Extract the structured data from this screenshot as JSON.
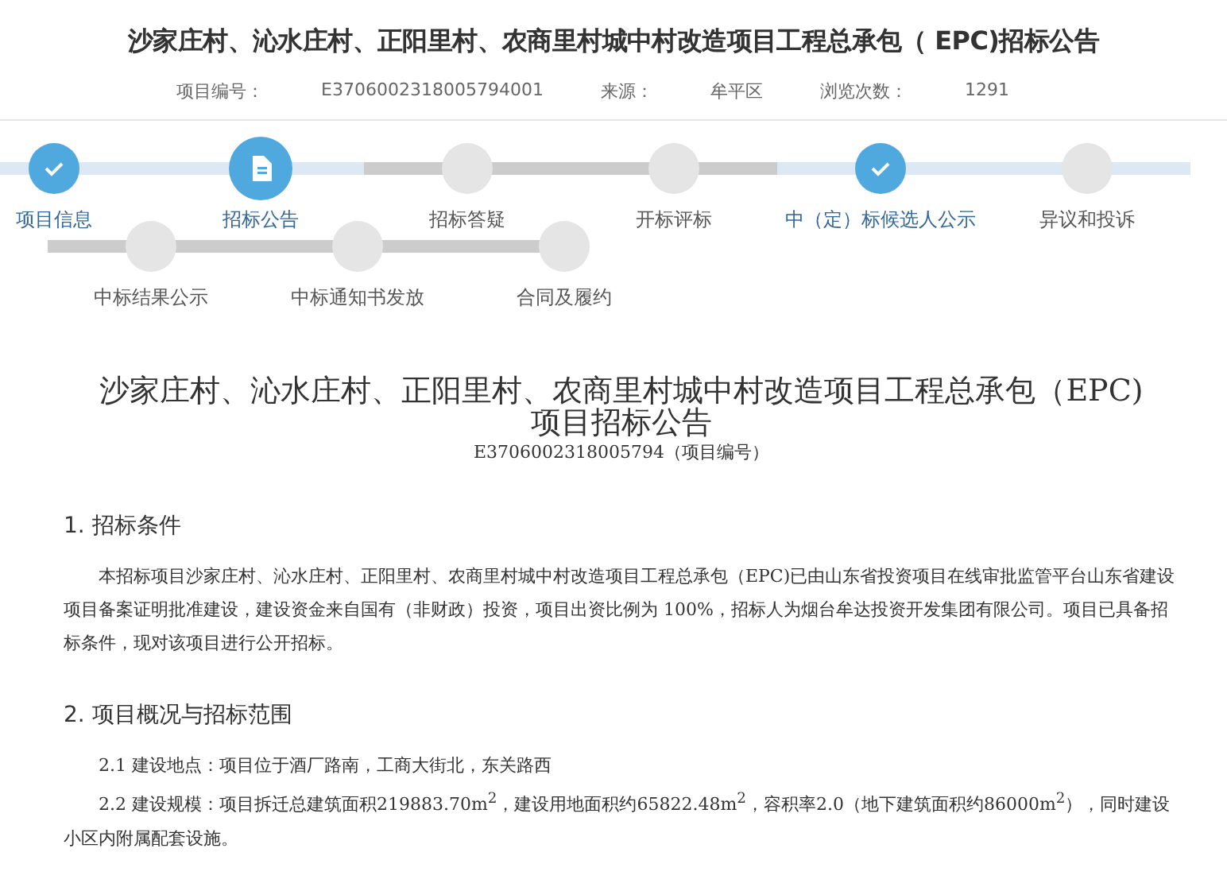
{
  "header": {
    "title": "沙家庄村、沁水庄村、正阳里村、农商里村城中村改造项目工程总承包（ EPC)招标公告",
    "meta": [
      {
        "label": "项目编号：",
        "value": "E3706002318005794001"
      },
      {
        "label": "来源：",
        "value": "牟平区"
      },
      {
        "label": "浏览次数：",
        "value": "1291"
      }
    ]
  },
  "steps": [
    [
      {
        "label": "项目信息",
        "completed": true,
        "selected": false,
        "highlighted": true
      },
      {
        "label": "招标公告",
        "completed": false,
        "selected": true,
        "highlighted": true
      },
      {
        "label": "招标答疑",
        "completed": false,
        "selected": false,
        "highlighted": false
      },
      {
        "label": "开标评标",
        "completed": false,
        "selected": false,
        "highlighted": false
      },
      {
        "label": "中（定）标候选人公示",
        "completed": true,
        "selected": false,
        "highlighted": true
      },
      {
        "label": "异议和投诉",
        "completed": false,
        "selected": false,
        "highlighted": true
      }
    ],
    [
      {
        "label": "中标结果公示",
        "completed": false,
        "selected": false,
        "highlighted": false
      },
      {
        "label": "中标通知书发放",
        "completed": false,
        "selected": false,
        "highlighted": false
      },
      {
        "label": "合同及履约",
        "completed": false,
        "selected": false,
        "highlighted": false
      }
    ]
  ],
  "document": {
    "title": "沙家庄村、沁水庄村、正阳里村、农商里村城中村改造项目工程总承包（EPC)项目招标公告",
    "code": "E3706002318005794（项目编号）",
    "sections": [
      {
        "heading": "1. 招标条件",
        "paragraphs": [
          {
            "text": "本招标项目沙家庄村、沁水庄村、正阳里村、农商里村城中村改造项目工程总承包（EPC)已由山东省投资项目在线审批监管平台山东省建设项目备案证明批准建设，建设资金来自国有（非财政）投资，项目出资比例为 100%，招标人为烟台牟达投资开发集团有限公司。项目已具备招标条件，现对该项目进行公开招标。"
          }
        ]
      },
      {
        "heading": "2. 项目概况与招标范围",
        "paragraphs": [
          {
            "text": "2.1 建设地点：项目位于酒厂路南，工商大街北，东关路西"
          },
          {
            "text": "2.2 建设规模：项目拆迁总建筑面积219883.70m$^{2}$，建设用地面积约65822.48m$^{2}$，容积率2.0（地下建筑面积约86000m$^{2}$），同时建设小区内附属配套设施。"
          }
        ]
      }
    ]
  }
}
